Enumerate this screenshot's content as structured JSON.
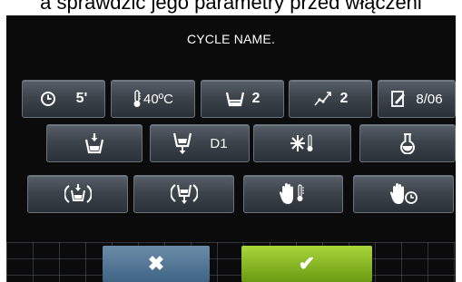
{
  "caption": "a sprawdzić jego parametry przed włączeni",
  "title": "CYCLE NAME.",
  "row1": {
    "time": {
      "icon": "clock-icon",
      "value": "5'"
    },
    "temperature": {
      "icon": "thermometer-icon",
      "value": "40ºC"
    },
    "water_level": {
      "icon": "water-level-icon",
      "value": "2"
    },
    "speed": {
      "icon": "speed-icon",
      "value": "2"
    },
    "detergent": {
      "icon": "detergent-dosing-icon",
      "value": "8/06"
    }
  },
  "row2": {
    "fill": {
      "icon": "fill-water-icon"
    },
    "drain": {
      "icon": "drain-icon",
      "value": "D1"
    },
    "cooling": {
      "icon": "cooling-icon"
    },
    "chemicals": {
      "icon": "flask-icon"
    }
  },
  "row3": {
    "rotate_fill": {
      "icon": "rotating-fill-icon"
    },
    "rotate_drain": {
      "icon": "rotating-drain-icon"
    },
    "manual_temperature": {
      "icon": "hand-thermometer-icon"
    },
    "manual_time": {
      "icon": "hand-clock-icon"
    }
  },
  "actions": {
    "cancel": {
      "icon": "close-icon",
      "label": "✖"
    },
    "confirm": {
      "icon": "check-icon",
      "label": "✔"
    }
  },
  "colors": {
    "confirm": "#8cc424",
    "cancel": "#50769a"
  }
}
